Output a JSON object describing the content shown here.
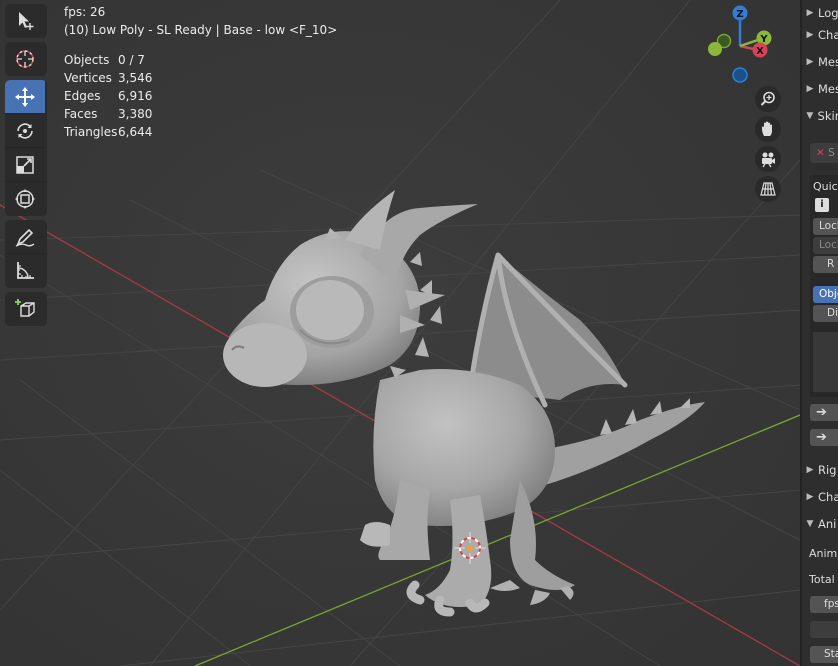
{
  "overlay": {
    "fps": "fps: 26",
    "title": "(10) Low Poly - SL Ready | Base - low <F_10>",
    "stats": [
      {
        "label": "Objects",
        "value": "0 / 7"
      },
      {
        "label": "Vertices",
        "value": "3,546"
      },
      {
        "label": "Edges",
        "value": "6,916"
      },
      {
        "label": "Faces",
        "value": "3,380"
      },
      {
        "label": "Triangles",
        "value": "6,644"
      }
    ]
  },
  "gizmo": {
    "z": "Z",
    "y": "Y",
    "x": "X"
  },
  "panel": {
    "headers": {
      "log": "Log",
      "cha1": "Cha",
      "mes1": "Mes",
      "mes2": "Mes",
      "skin": "Skin",
      "rig": "Rig",
      "cha2": "Cha",
      "ani": "Ani"
    },
    "quick_label": "Quick",
    "lock1": "Lock",
    "lock2": "Lock",
    "r_btn": "R",
    "object_btn": "Obje",
    "di_btn": "Di",
    "anim_label": "Anima",
    "total_label": "Total A",
    "fps_btn": "fps",
    "sta_btn": "Sta",
    "s_btn": "S"
  },
  "colors": {
    "accent": "#4772b3",
    "x_axis": "#c84c5a",
    "y_axis": "#8bb83a",
    "z_axis": "#2f7fd8"
  }
}
